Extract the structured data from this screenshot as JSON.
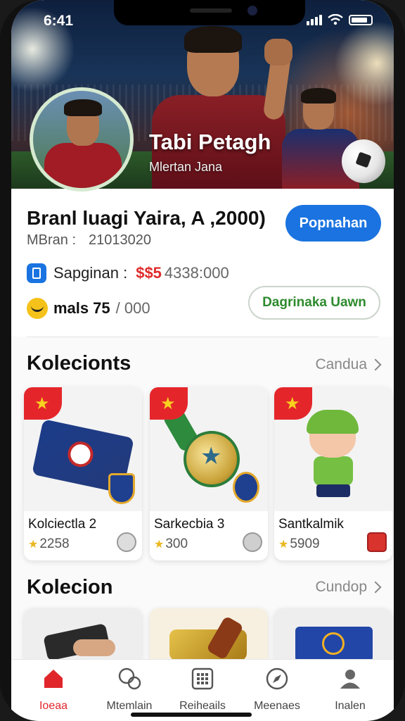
{
  "status": {
    "time": "6:41"
  },
  "hero": {
    "name": "Tabi Petagh",
    "subtitle": "Mlertan Jana"
  },
  "profile": {
    "title": "Branl luagi Yaira, A ,2000)",
    "id_label": "MBran :",
    "id_value": "21013020",
    "primary_button": "Popnahan",
    "balance_label": "Sapginan :",
    "balance_red": "$$5",
    "balance_gray": "4338:000",
    "points_label": "mals",
    "points_bold": "75",
    "points_gray": "/ 000",
    "secondary_button": "Dagrinaka Uawn"
  },
  "section1": {
    "title": "Kolecionts",
    "link": "Candua",
    "cards": [
      {
        "name": "Kolciectla 2",
        "points": "2258"
      },
      {
        "name": "Sarkecbia 3",
        "points": "300"
      },
      {
        "name": "Santkalmik",
        "points": "5909"
      }
    ]
  },
  "section2": {
    "title": "Kolecion",
    "link": "Cundop"
  },
  "tabs": [
    {
      "label": "Ioeaa",
      "icon": "home-icon"
    },
    {
      "label": "Mtemlain",
      "icon": "ball-icon"
    },
    {
      "label": "Reiheails",
      "icon": "grid-icon"
    },
    {
      "label": "Meenaes",
      "icon": "compass-icon"
    },
    {
      "label": "Inalen",
      "icon": "profile-icon"
    }
  ],
  "colors": {
    "accent": "#1a73e0",
    "red": "#e0262b",
    "green": "#2e8a2e"
  }
}
